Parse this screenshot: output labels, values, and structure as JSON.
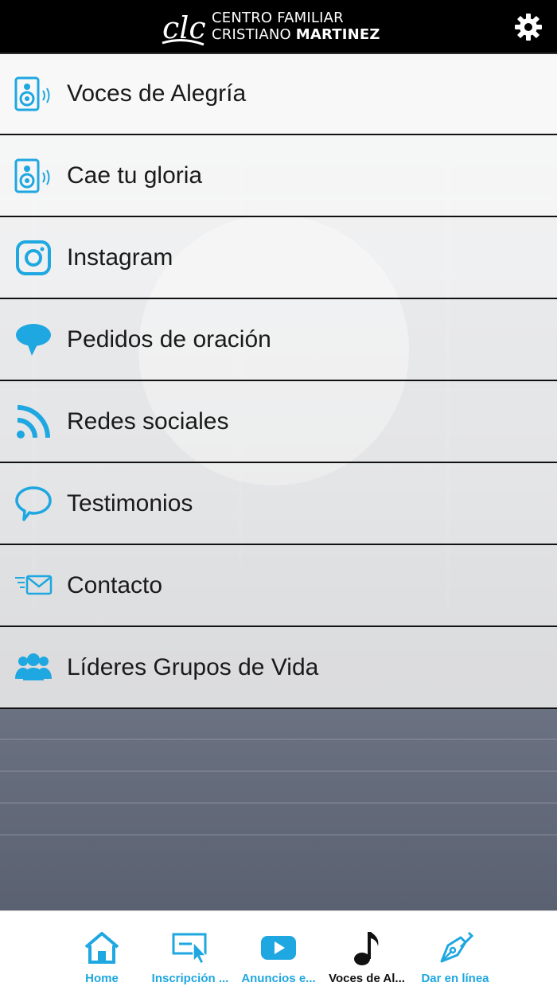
{
  "header": {
    "logo_text_line1": "CENTRO FAMILIAR",
    "logo_text_line2_a": "CRISTIANO ",
    "logo_text_line2_b": "MARTINEZ",
    "logo_mark_text": "clc",
    "settings_icon": "gear-icon"
  },
  "menu": {
    "items": [
      {
        "label": "Voces de Alegría",
        "icon": "speaker-icon"
      },
      {
        "label": "Cae tu gloria",
        "icon": "speaker-icon"
      },
      {
        "label": "Instagram",
        "icon": "instagram-icon"
      },
      {
        "label": "Pedidos de oración",
        "icon": "speech-bubble-filled-icon"
      },
      {
        "label": "Redes sociales",
        "icon": "rss-icon"
      },
      {
        "label": "Testimonios",
        "icon": "speech-bubble-outline-icon"
      },
      {
        "label": "Contacto",
        "icon": "envelope-icon"
      },
      {
        "label": "Líderes Grupos de Vida",
        "icon": "people-icon"
      }
    ]
  },
  "tabbar": {
    "tabs": [
      {
        "label": "Home",
        "icon": "home-icon",
        "active": false
      },
      {
        "label": "Inscripción ...",
        "icon": "cursor-click-icon",
        "active": false
      },
      {
        "label": "Anuncios e...",
        "icon": "youtube-play-icon",
        "active": false
      },
      {
        "label": "Voces de Al...",
        "icon": "music-note-icon",
        "active": true
      },
      {
        "label": "Dar en línea",
        "icon": "pen-nib-icon",
        "active": false
      }
    ]
  },
  "colors": {
    "accent": "#1ea7e0",
    "header_bg": "#000000",
    "active_tab": "#111111"
  }
}
